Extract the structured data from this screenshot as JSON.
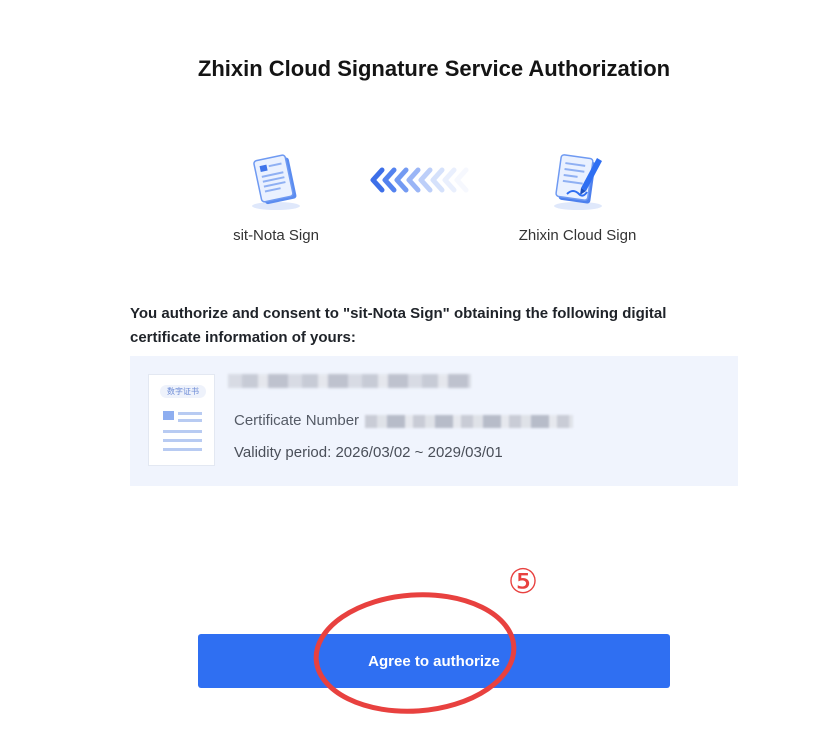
{
  "header": {
    "title": "Zhixin Cloud Signature Service Authorization"
  },
  "apps": {
    "requester": {
      "name": "sit-Nota Sign",
      "icon": "document-icon"
    },
    "provider": {
      "name": "Zhixin Cloud Sign",
      "icon": "signing-document-icon"
    },
    "direction_icon": "chevron-left-arrows-icon"
  },
  "consent": {
    "text": "You authorize and consent to \"sit-Nota Sign\" obtaining the following digital certificate information of yours:"
  },
  "certificate": {
    "thumbnail_label": "数字证书",
    "number_label": "Certificate Number",
    "validity_label": "Validity period: 2026/03/02 ~ 2029/03/01"
  },
  "annotation": {
    "step_number": "⑤",
    "color": "#e8413f"
  },
  "actions": {
    "agree_label": "Agree to authorize"
  },
  "colors": {
    "accent": "#2f6ff2",
    "panel": "#f0f4fd"
  }
}
